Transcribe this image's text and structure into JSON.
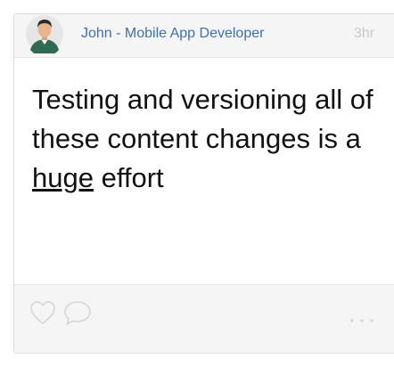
{
  "post": {
    "author": "John - Mobile App Developer",
    "timestamp": "3hr",
    "text_before": "Testing and versioning all of these content changes is a ",
    "text_emphasis": "huge",
    "text_after": " effort"
  },
  "icons": {
    "avatar": "avatar-person-icon",
    "like": "heart-icon",
    "comment": "speech-bubble-icon",
    "more": "more-dots-icon"
  },
  "colors": {
    "author_link": "#3d6fb6",
    "timestamp": "#c8c8c8",
    "icon_outline": "#d6d6d6",
    "header_footer_bg": "#f5f5f5"
  }
}
